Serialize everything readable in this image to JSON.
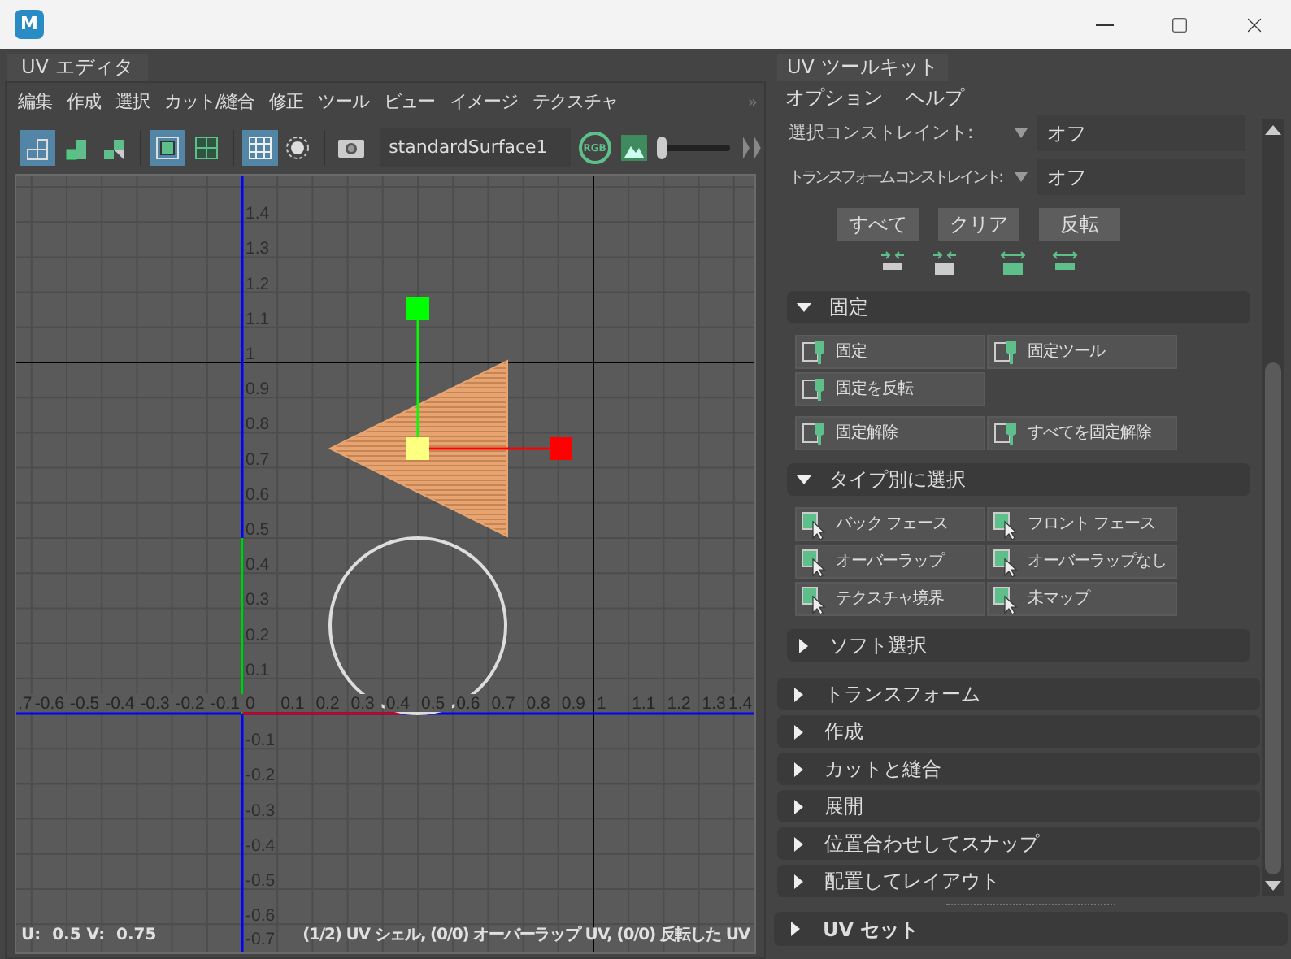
{
  "window": {
    "logo": "M"
  },
  "uv_editor": {
    "tab": "UV エディタ",
    "menu": [
      "編集",
      "作成",
      "選択",
      "カット/縫合",
      "修正",
      "ツール",
      "ビュー",
      "イメージ",
      "テクスチャ"
    ],
    "menu_overflow": "»",
    "toolbar": {
      "tools": [
        {
          "selected": true
        },
        {
          "selected": false
        },
        {
          "selected": false
        },
        {
          "selected": true
        },
        {
          "selected": false
        },
        {
          "selected": true
        },
        {
          "selected": false
        }
      ],
      "shader": "standardSurface1",
      "channels": "RGB",
      "slider": {
        "level": 0
      }
    },
    "viewport": {
      "u_labels": [
        ".7",
        "-0.6",
        "-0.5",
        "-0.4",
        "-0.3",
        "-0.2",
        "-0.1",
        "0",
        "0.1",
        "0.2",
        "0.3",
        "0.4",
        "0.5",
        "0.6",
        "0.7",
        "0.8",
        "0.9",
        "1",
        "1.1",
        "1.2",
        "1.3",
        "1.4"
      ],
      "v_labels_positive": [
        "1.4",
        "1.3",
        "1.2",
        "1.1",
        "1",
        "0.9",
        "0.8",
        "0.7",
        "0.6",
        "0.5",
        "0.4",
        "0.3",
        "0.2",
        "0.1"
      ],
      "v_labels_negative": [
        "-0.1",
        "-0.2",
        "-0.3",
        "-0.4",
        "-0.5",
        "-0.6",
        "-0.7"
      ],
      "status_left": "U:  0.5 V:  0.75",
      "status_right": "(1/2) UV シェル, (0/0) オーバーラップ UV, (0/0) 反転した UV"
    }
  },
  "uv_toolkit": {
    "tab": "UV ツールキット",
    "menu": [
      "オプション",
      "ヘルプ"
    ],
    "constraints": [
      {
        "label": "選択コンストレイント:",
        "value": "オフ"
      },
      {
        "label": "トランスフォーム コンストレイント:",
        "value": "オフ"
      }
    ],
    "buttons": [
      "すべて",
      "クリア",
      "反転"
    ],
    "sections": [
      {
        "title": "固定",
        "kind": "pin",
        "expanded": true,
        "groups": [
          [
            "固定",
            "固定ツール",
            "固定を反転"
          ],
          [
            "固定解除",
            "すべてを固定解除"
          ]
        ]
      },
      {
        "title": "タイプ別に選択",
        "kind": "select",
        "expanded": true,
        "groups": [
          [
            "バック フェース",
            "フロント フェース",
            "オーバーラップ",
            "オーバーラップなし",
            "テクスチャ境界",
            "未マップ"
          ]
        ]
      },
      {
        "title": "ソフト選択",
        "expanded": false
      }
    ],
    "panels": [
      {
        "title": "トランスフォーム",
        "expanded": false
      },
      {
        "title": "作成",
        "expanded": false
      },
      {
        "title": "カットと縫合",
        "expanded": false
      },
      {
        "title": "展開",
        "expanded": false
      },
      {
        "title": "位置合わせしてスナップ",
        "expanded": false
      },
      {
        "title": "配置してレイアウト",
        "expanded": false
      }
    ],
    "uv_sets": {
      "title": "UV セット",
      "expanded": false
    }
  }
}
